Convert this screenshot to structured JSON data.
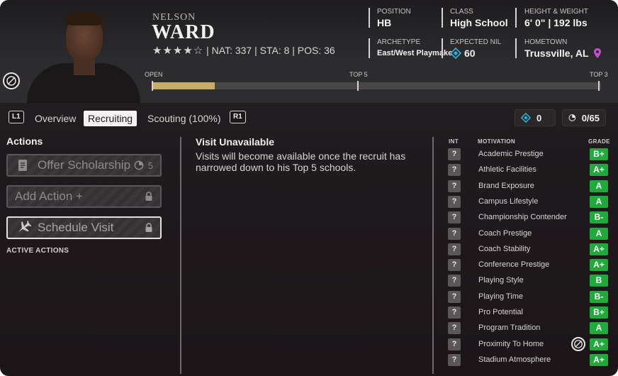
{
  "player": {
    "first_name": "NELSON",
    "last_name": "WARD",
    "stars_filled": "★★★★",
    "stars_empty": "☆",
    "star_rating": 4,
    "stats_line": "| NAT: 337 | STA: 8 | POS: 36"
  },
  "info": {
    "position_label": "POSITION",
    "position_value": "HB",
    "class_label": "CLASS",
    "class_value": "High School",
    "hw_label": "HEIGHT & WEIGHT",
    "hw_value": "6' 0\" | 192 lbs",
    "archetype_label": "ARCHETYPE",
    "archetype_value": "East/West Playmaker",
    "nil_label": "EXPECTED NIL",
    "nil_value": "60",
    "hometown_label": "HOMETOWN",
    "hometown_value": "Trussville, AL"
  },
  "progress": {
    "label_open": "OPEN",
    "label_top5": "TOP 5",
    "label_top3": "TOP 3",
    "fill_fraction": 0.14
  },
  "tabs": {
    "left_button": "L1",
    "right_button": "R1",
    "items": [
      "Overview",
      "Recruiting",
      "Scouting (100%)"
    ],
    "active": "Recruiting"
  },
  "counters": {
    "diamonds": "0",
    "hours": "0/65"
  },
  "actions": {
    "title": "Actions",
    "offer_scholarship": "Offer Scholarship",
    "offer_cost": "5",
    "add_action": "Add Action +",
    "schedule_visit": "Schedule Visit",
    "active_actions_label": "ACTIVE ACTIONS"
  },
  "visit": {
    "title": "Visit Unavailable",
    "message": "Visits will become available once the recruit has narrowed down to his Top 5 schools."
  },
  "motivations": {
    "header_int": "INT",
    "header_motivation": "MOTIVATION",
    "header_grade": "GRADE",
    "rows": [
      {
        "int": "?",
        "label": "Academic Prestige",
        "grade": "B+"
      },
      {
        "int": "?",
        "label": "Athletic Facilities",
        "grade": "A+"
      },
      {
        "int": "?",
        "label": "Brand Exposure",
        "grade": "A"
      },
      {
        "int": "?",
        "label": "Campus Lifestyle",
        "grade": "A"
      },
      {
        "int": "?",
        "label": "Championship Contender",
        "grade": "B-"
      },
      {
        "int": "?",
        "label": "Coach Prestige",
        "grade": "A"
      },
      {
        "int": "?",
        "label": "Coach Stability",
        "grade": "A+"
      },
      {
        "int": "?",
        "label": "Conference Prestige",
        "grade": "A+"
      },
      {
        "int": "?",
        "label": "Playing Style",
        "grade": "B"
      },
      {
        "int": "?",
        "label": "Playing Time",
        "grade": "B-"
      },
      {
        "int": "?",
        "label": "Pro Potential",
        "grade": "B+"
      },
      {
        "int": "?",
        "label": "Program Tradition",
        "grade": "A"
      },
      {
        "int": "?",
        "label": "Proximity To Home",
        "grade": "A+"
      },
      {
        "int": "?",
        "label": "Stadium Atmosphere",
        "grade": "A+"
      }
    ]
  },
  "colors": {
    "grade_green": "#1faa3b",
    "progress_gold": "#c6ae6a",
    "hometown_pin": "#c44fd1",
    "nil_diamond": "#3ab7d8"
  }
}
